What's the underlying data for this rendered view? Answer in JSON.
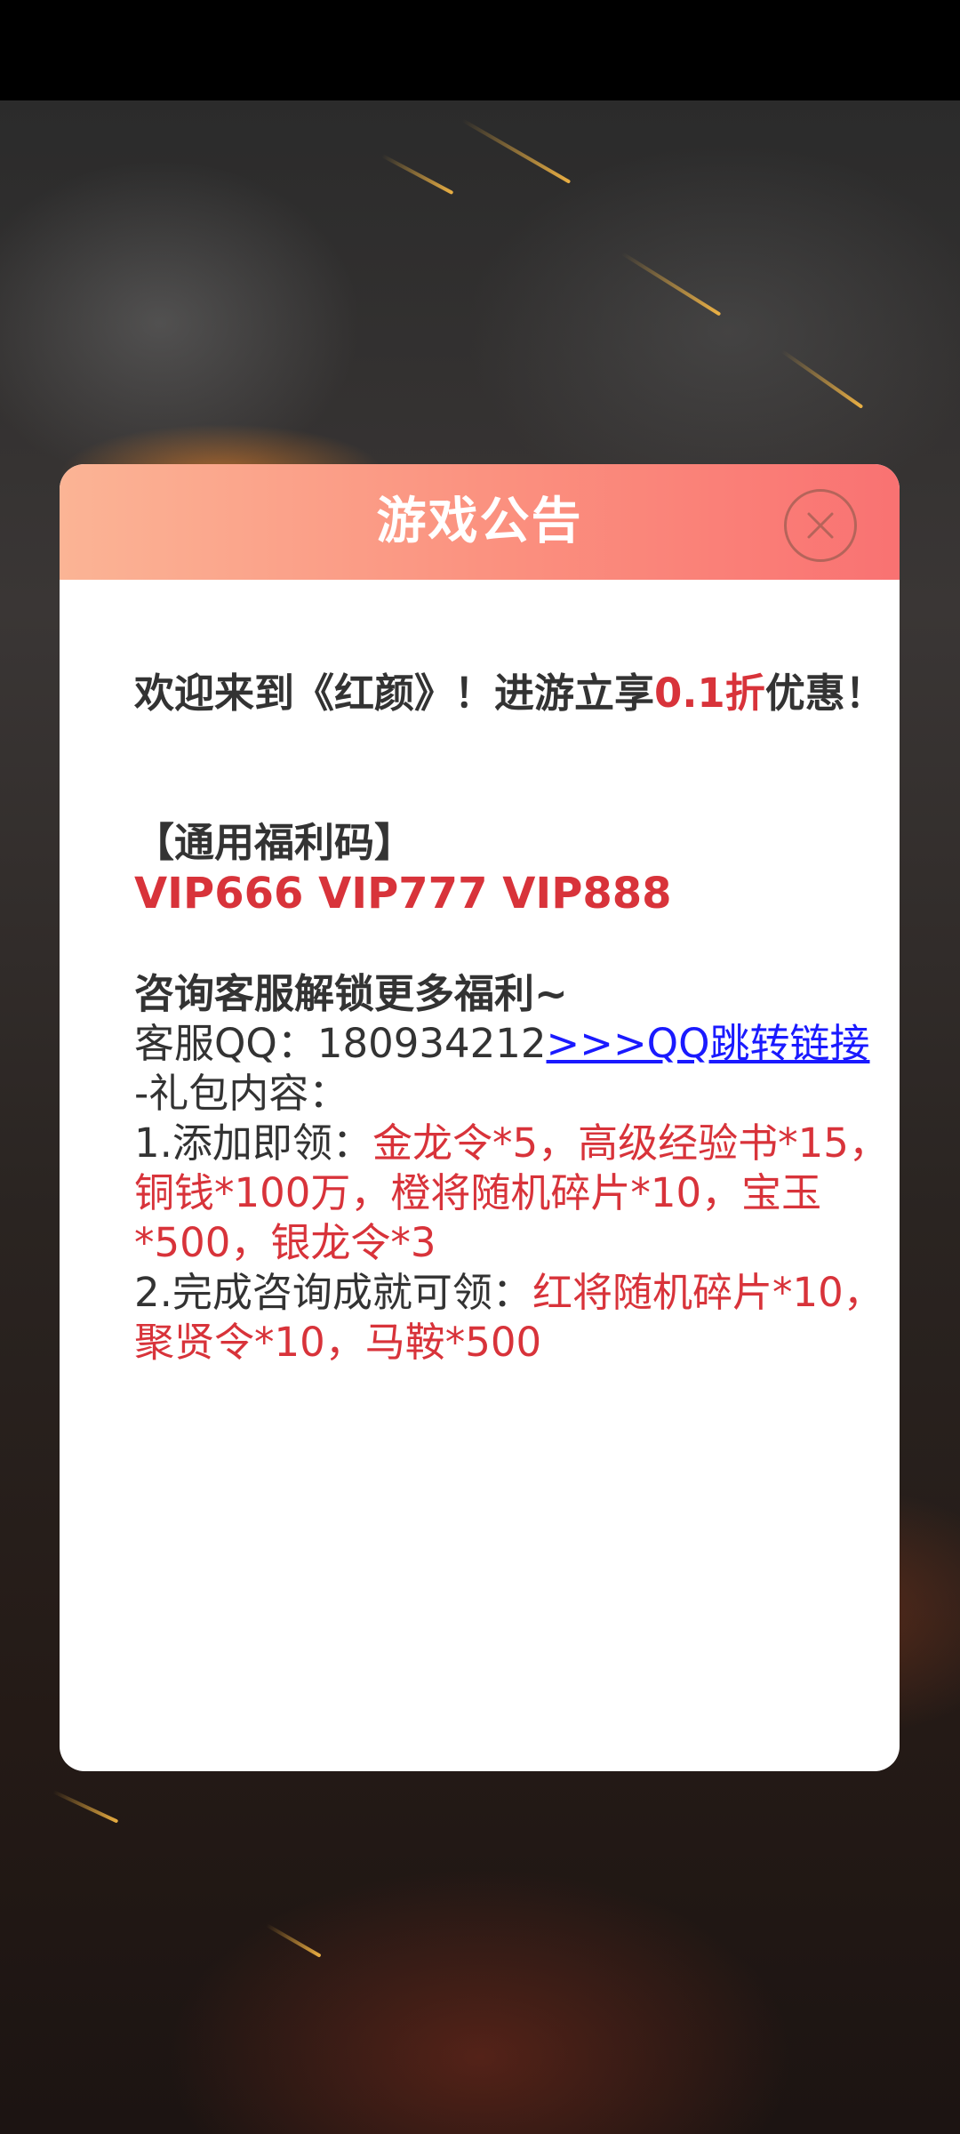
{
  "notice": {
    "title": "游戏公告",
    "welcome_prefix": "欢迎来到《红颜》！进游立享",
    "welcome_discount": "0.1折",
    "welcome_suffix": "优惠！",
    "code_section_title": "【通用福利码】",
    "codes": "VIP666 VIP777 VIP888",
    "consult_line": "咨询客服解锁更多福利~",
    "qq_label": "客服QQ：",
    "qq_number": "180934212",
    "qq_link_text": ">>>QQ跳转链接",
    "gift_header": "-礼包内容：",
    "gift_1_label": "1.添加即领：",
    "gift_1_items": "金龙令*5，高级经验书*15，铜钱*100万，橙将随机碎片*10，宝玉*500，银龙令*3",
    "gift_2_label": "2.完成咨询成就可领：",
    "gift_2_items": "红将随机碎片*10，聚贤令*10，马鞍*500"
  },
  "icons": {
    "close": "close-icon"
  },
  "colors": {
    "header_gradient_start": "#fbb495",
    "header_gradient_end": "#f97272",
    "highlight_red": "#d8333a",
    "link_blue": "#1a1aff",
    "body_text": "#333333"
  }
}
